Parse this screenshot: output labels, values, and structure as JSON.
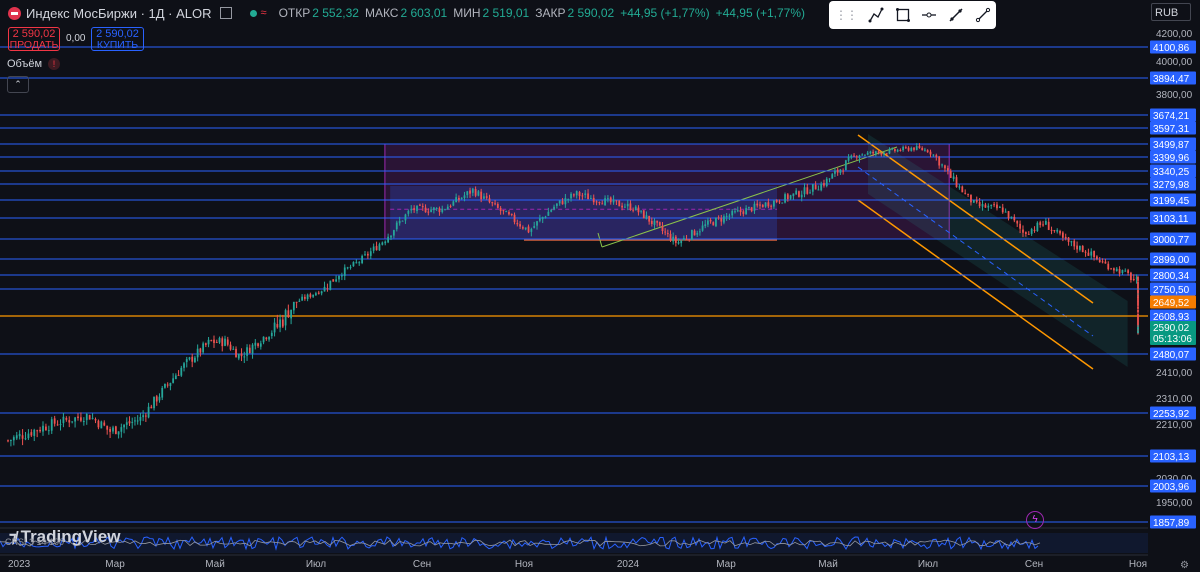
{
  "header": {
    "title": "Индекс МосБиржи · 1Д · ALOR",
    "ohlc": [
      {
        "label": "ОТКР",
        "value": "2 552,32"
      },
      {
        "label": "МАКС",
        "value": "2 603,01"
      },
      {
        "label": "МИН",
        "value": "2 519,01"
      },
      {
        "label": "ЗАКР",
        "value": "2 590,02"
      }
    ],
    "change": "+44,95 (+1,77%)",
    "change2": "+44,95 (+1,77%)"
  },
  "trade": {
    "sell_price": "2 590,02",
    "sell_label": "ПРОДАТЬ",
    "spread": "0,00",
    "buy_price": "2 590,02",
    "buy_label": "КУПИТЬ"
  },
  "volume_label": "Объём",
  "currency": "RUB",
  "brand": "TradingView",
  "indicator_label": "CRSI 3 14 100",
  "colors": {
    "bg": "#0e1017",
    "level": "#2962ff",
    "orange": "#ff9800",
    "up": "#26a69a",
    "down": "#ef5350",
    "purple": "#9c27b0",
    "current": "#089981",
    "highlight": "#f57c00"
  },
  "chart_data": {
    "type": "candlestick",
    "title": "Индекс МосБиржи · 1Д",
    "y_range": [
      1830,
      4260
    ],
    "x_ticks": [
      "2023",
      "Мар",
      "Май",
      "Июл",
      "Сен",
      "Ноя",
      "2024",
      "Мар",
      "Май",
      "Июл",
      "Сен",
      "Ноя"
    ],
    "y_ticks": [
      "4200,00",
      "4000,00",
      "3800,00",
      "2410,00",
      "2310,00",
      "2210,00",
      "2030,00",
      "1950,00"
    ],
    "levels": [
      4100.86,
      3894.47,
      3674.21,
      3597.31,
      3499.87,
      3399.96,
      3340.25,
      3279.98,
      3199.45,
      3103.11,
      3000.77,
      2899.0,
      2800.34,
      2750.5,
      2608.93,
      2480.07,
      2253.92,
      2103.13,
      2003.96,
      1857.89
    ],
    "level_labels": [
      "4100,86",
      "3894,47",
      "3674,21",
      "3597,31",
      "3499,87",
      "3399,96",
      "3340,25",
      "3279,98",
      "3199,45",
      "3103,11",
      "3000,77",
      "2899,00",
      "2800,34",
      "2750,50",
      "2608,93",
      "2480,07",
      "2253,92",
      "2103,13",
      "2003,96",
      "1857,89"
    ],
    "highlight_level": {
      "value": 2649.52,
      "label": "2649,52"
    },
    "current": {
      "value": 2590.02,
      "label": "2590,02",
      "timer": "05:13:06"
    },
    "orange_level": 2608.93,
    "series_close": [
      {
        "m": 0.0,
        "v": 2155
      },
      {
        "m": 0.8,
        "v": 2210
      },
      {
        "m": 1.5,
        "v": 2245
      },
      {
        "m": 1.9,
        "v": 2185
      },
      {
        "m": 2.5,
        "v": 2230
      },
      {
        "m": 3.3,
        "v": 2420
      },
      {
        "m": 3.9,
        "v": 2530
      },
      {
        "m": 4.2,
        "v": 2530
      },
      {
        "m": 4.5,
        "v": 2470
      },
      {
        "m": 4.9,
        "v": 2540
      },
      {
        "m": 5.5,
        "v": 2630
      },
      {
        "m": 6.2,
        "v": 2760
      },
      {
        "m": 6.8,
        "v": 2880
      },
      {
        "m": 7.3,
        "v": 3000
      },
      {
        "m": 7.8,
        "v": 3150
      },
      {
        "m": 8.4,
        "v": 3150
      },
      {
        "m": 9.0,
        "v": 3250
      },
      {
        "m": 9.6,
        "v": 3130
      },
      {
        "m": 10.1,
        "v": 3040
      },
      {
        "m": 10.6,
        "v": 3170
      },
      {
        "m": 11.0,
        "v": 3230
      },
      {
        "m": 11.6,
        "v": 3190
      },
      {
        "m": 12.1,
        "v": 3160
      },
      {
        "m": 12.6,
        "v": 3060
      },
      {
        "m": 13.0,
        "v": 2980
      },
      {
        "m": 13.6,
        "v": 3070
      },
      {
        "m": 14.2,
        "v": 3130
      },
      {
        "m": 14.8,
        "v": 3180
      },
      {
        "m": 15.4,
        "v": 3230
      },
      {
        "m": 15.9,
        "v": 3280
      },
      {
        "m": 16.6,
        "v": 3420
      },
      {
        "m": 17.2,
        "v": 3440
      },
      {
        "m": 17.7,
        "v": 3470
      },
      {
        "m": 18.0,
        "v": 3450
      },
      {
        "m": 18.4,
        "v": 3320
      },
      {
        "m": 18.9,
        "v": 3170
      },
      {
        "m": 19.4,
        "v": 3150
      },
      {
        "m": 19.8,
        "v": 3030
      },
      {
        "m": 20.2,
        "v": 3080
      },
      {
        "m": 20.6,
        "v": 2990
      },
      {
        "m": 21.0,
        "v": 2940
      },
      {
        "m": 21.4,
        "v": 2860
      },
      {
        "m": 21.9,
        "v": 2790
      },
      {
        "m": 22.3,
        "v": 2700
      },
      {
        "m": 22.6,
        "v": 2650
      },
      {
        "m": 22.8,
        "v": 2580
      },
      {
        "m": 22.9,
        "v": 2590
      }
    ],
    "oscillator": {
      "name": "CRSI",
      "period": [
        3,
        14,
        100
      ]
    }
  }
}
